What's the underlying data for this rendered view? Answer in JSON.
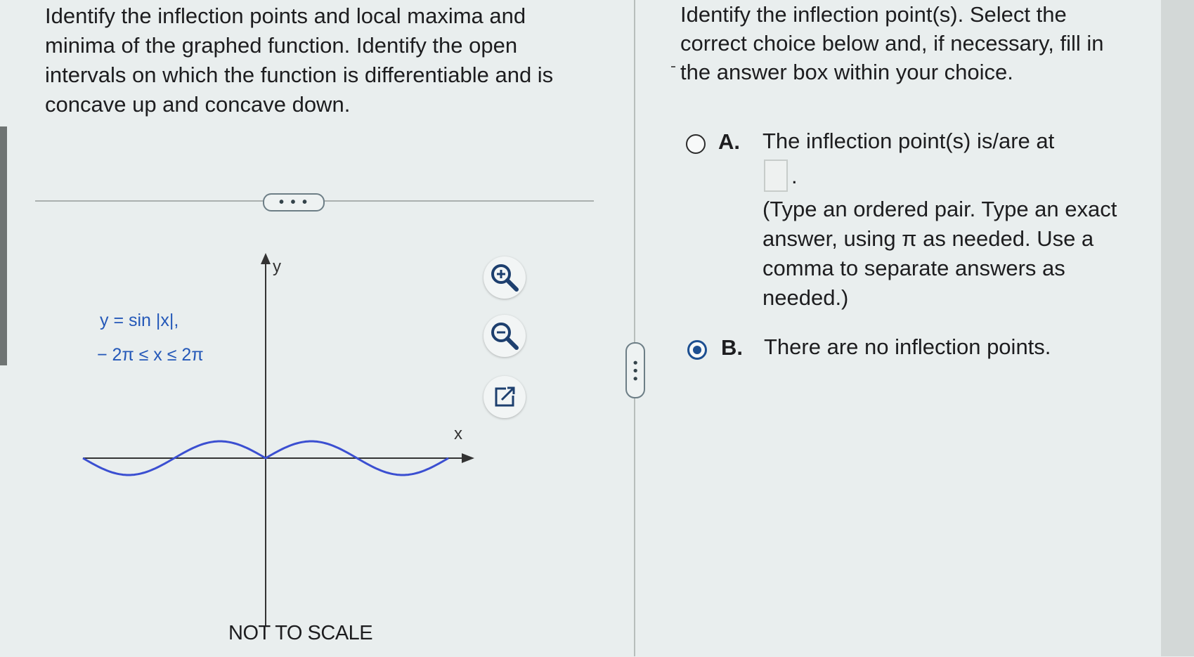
{
  "problem": {
    "prompt": "Identify the inflection points and local maxima and minima of the graphed function. Identify the open intervals on which the function is differentiable and is concave up and concave down."
  },
  "divider": {
    "expand_label": "• • •"
  },
  "graph": {
    "function_label": "y = sin |x|,",
    "domain_label": "− 2π ≤ x ≤ 2π",
    "x_axis_label": "x",
    "y_axis_label": "y",
    "note": "NOT TO SCALE",
    "curve_color": "#3b4fd1"
  },
  "tools": {
    "zoom_in_icon": "zoom-in-icon",
    "zoom_out_icon": "zoom-out-icon",
    "popout_icon": "external-link-icon"
  },
  "side_splitter": {
    "label": "• • •"
  },
  "question": {
    "text": "Identify the inflection point(s). Select the correct choice below and, if necessary, fill in the answer box within your choice.",
    "choices": [
      {
        "letter": "A.",
        "text": "The inflection point(s) is/are at",
        "answer_value": "",
        "answer_suffix": ".",
        "hint": "(Type an ordered pair. Type an exact answer, using π as needed. Use a comma to separate answers as needed.)",
        "selected": false
      },
      {
        "letter": "B.",
        "text": "There are no inflection points.",
        "selected": true
      }
    ]
  },
  "colors": {
    "background": "#e9eeee",
    "accent": "#1d4f91",
    "curve": "#3b4fd1"
  }
}
